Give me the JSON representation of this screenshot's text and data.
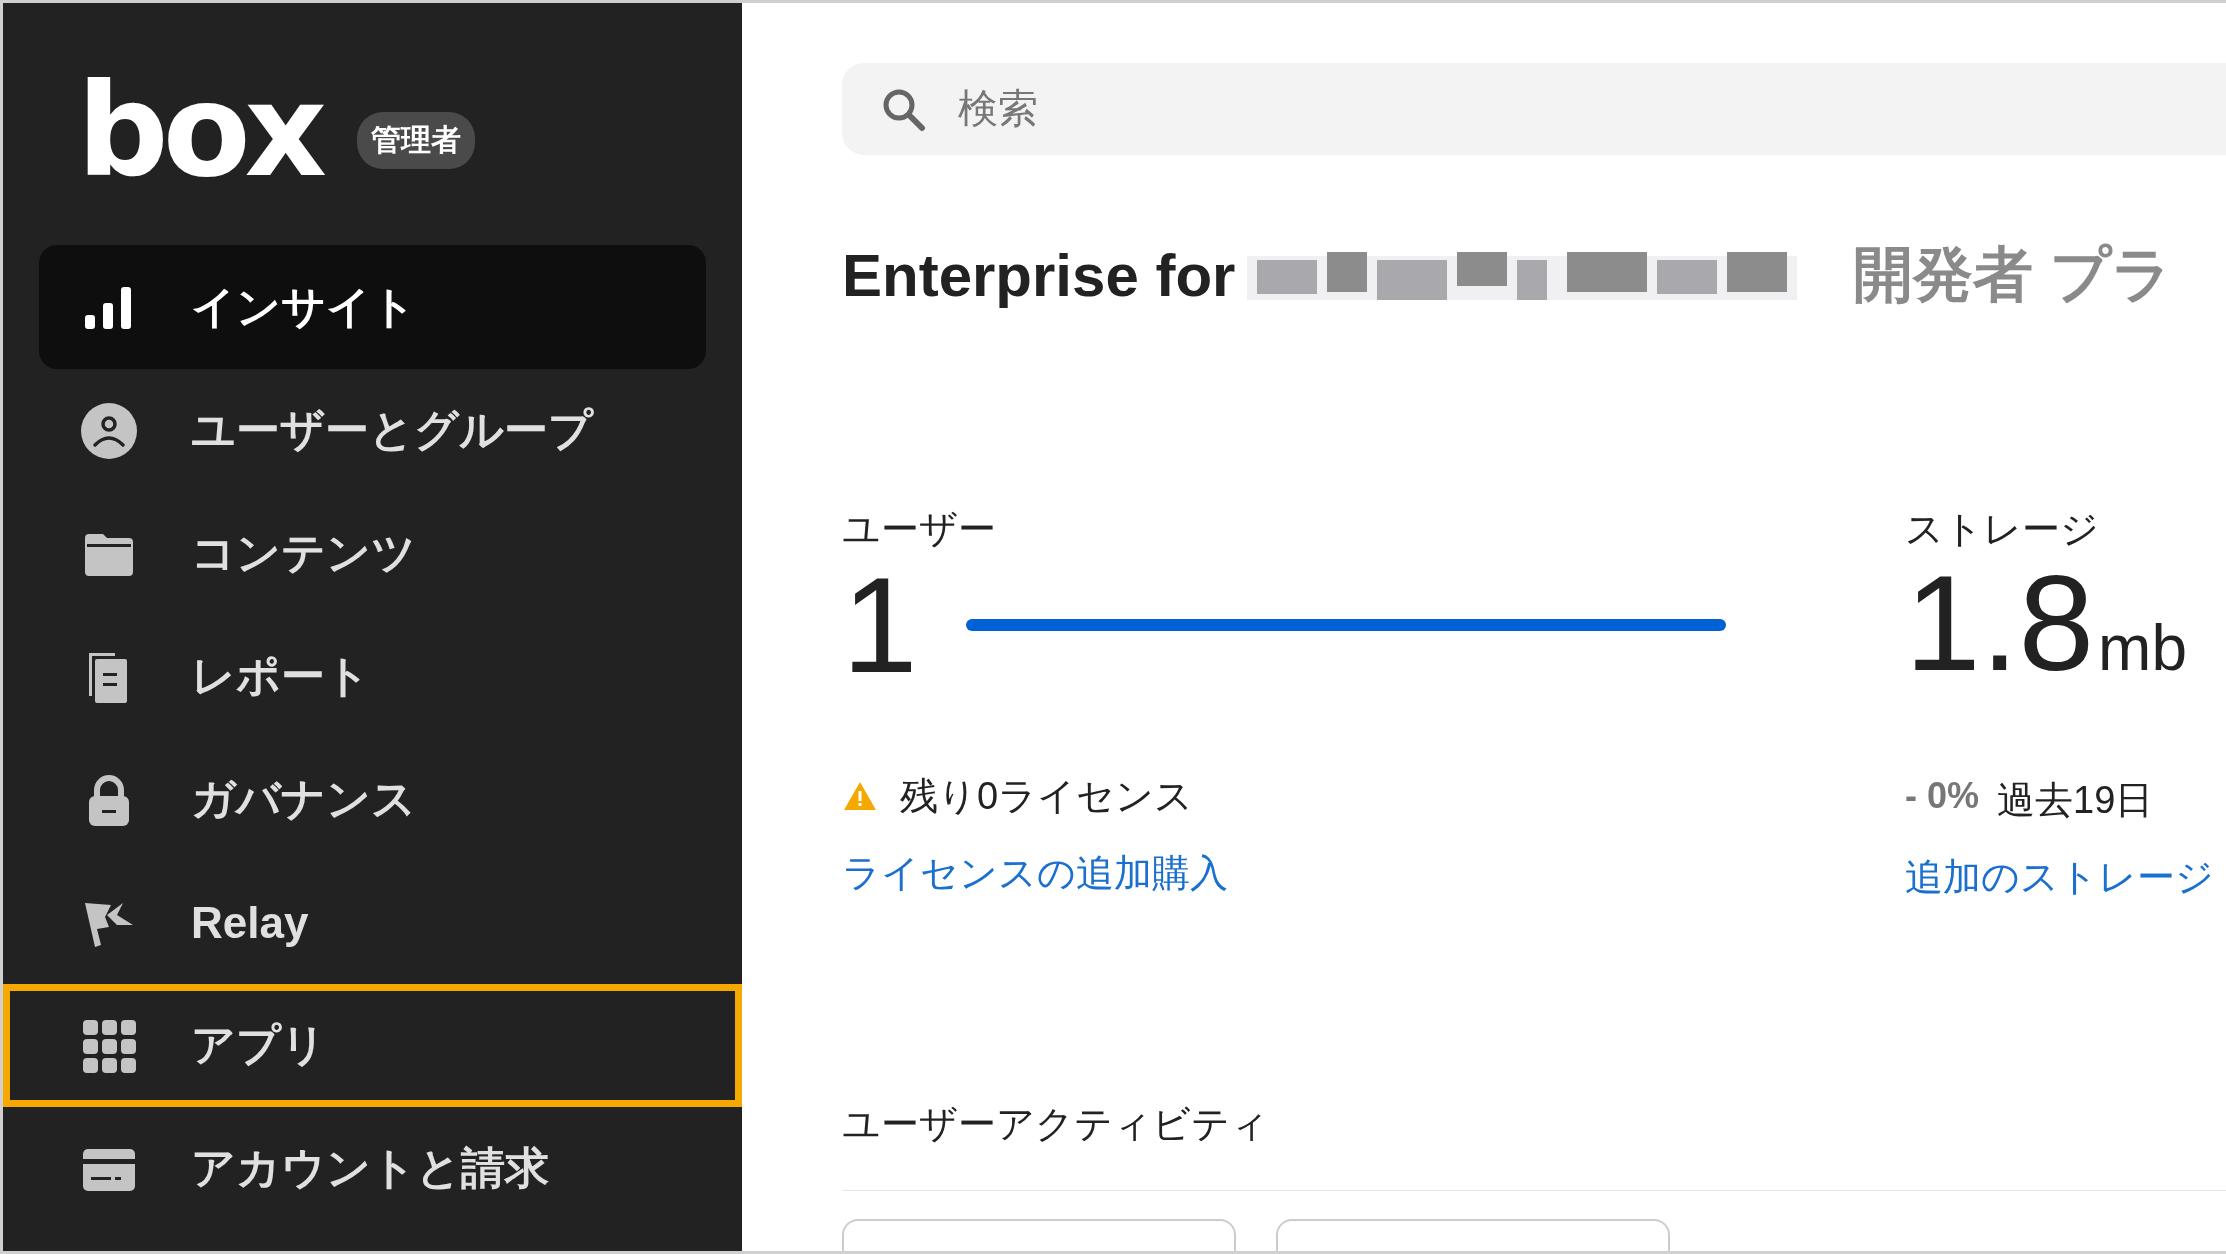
{
  "sidebar": {
    "logo": "box",
    "badge": "管理者",
    "items": [
      {
        "label": "インサイト",
        "selected": true,
        "highlighted": false
      },
      {
        "label": "ユーザーとグループ",
        "selected": false,
        "highlighted": false
      },
      {
        "label": "コンテンツ",
        "selected": false,
        "highlighted": false
      },
      {
        "label": "レポート",
        "selected": false,
        "highlighted": false
      },
      {
        "label": "ガバナンス",
        "selected": false,
        "highlighted": false
      },
      {
        "label": "Relay",
        "selected": false,
        "highlighted": false
      },
      {
        "label": "アプリ",
        "selected": false,
        "highlighted": true
      },
      {
        "label": "アカウントと請求",
        "selected": false,
        "highlighted": false
      }
    ]
  },
  "search": {
    "placeholder": "検索"
  },
  "heading": {
    "title": "Enterprise for",
    "plan": "開発者 プラ"
  },
  "stats": {
    "users": {
      "label": "ユーザー",
      "value": "1",
      "level": 1,
      "warning": "残り0ライセンス",
      "link": "ライセンスの追加購入"
    },
    "storage": {
      "label": "ストレージ",
      "value": "1.8",
      "unit": "mb",
      "change": "- 0%",
      "period": "過去19日",
      "link": "追加のストレージ"
    }
  },
  "activity": {
    "title": "ユーザーアクティビティ"
  }
}
